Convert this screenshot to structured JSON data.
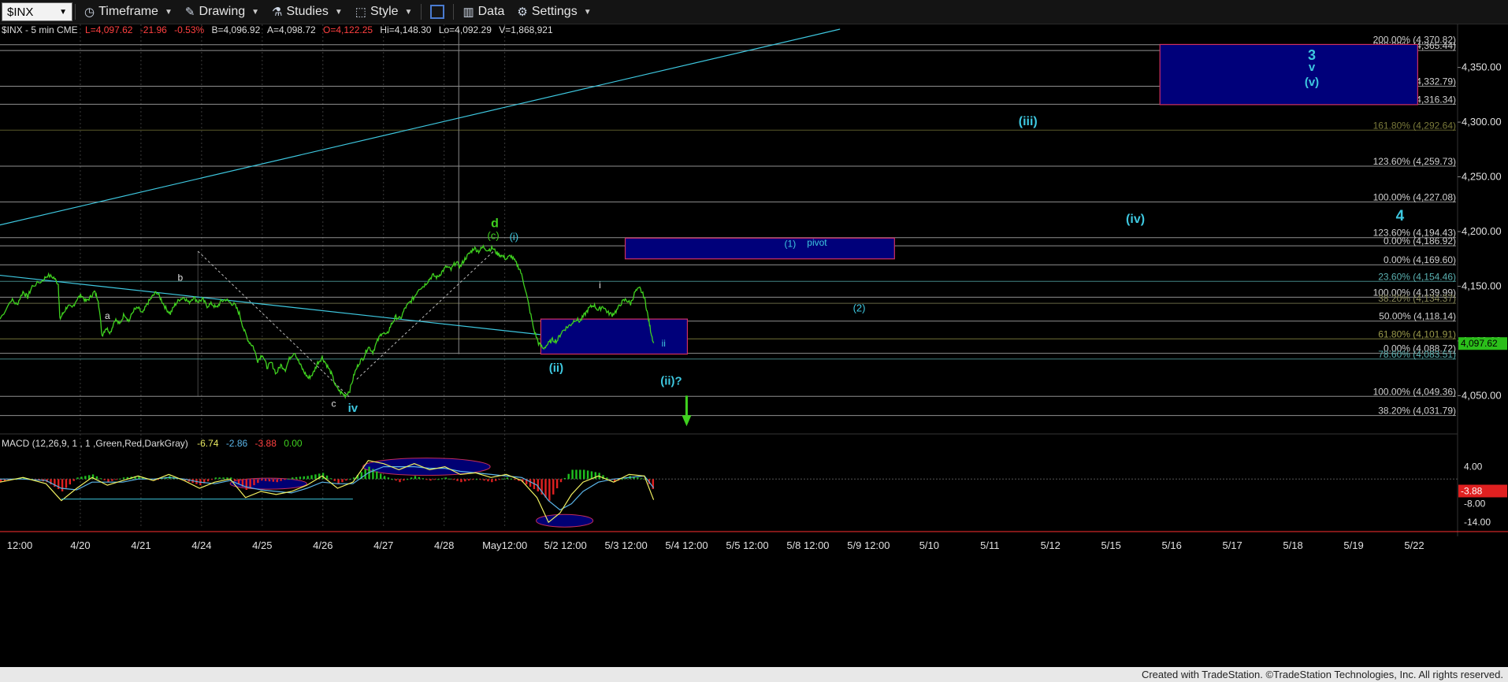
{
  "toolbar": {
    "symbol": "$INX",
    "timeframe": "Timeframe",
    "drawing": "Drawing",
    "studies": "Studies",
    "style": "Style",
    "data": "Data",
    "settings": "Settings"
  },
  "header": {
    "symbol_desc": "$INX - 5 min  CME",
    "last": "L=4,097.62",
    "chg": "-21.96",
    "pct": "-0.53%",
    "bid": "B=4,096.92",
    "ask": "A=4,098.72",
    "open": "O=4,122.25",
    "high": "Hi=4,148.30",
    "low": "Lo=4,092.29",
    "vol": "V=1,868,921"
  },
  "macd_header": {
    "name": "MACD (12,26,9, 1 , 1 ,Green,Red,DarkGray)",
    "v1": "-6.74",
    "v2": "-2.86",
    "v3": "-3.88",
    "v4": "0.00"
  },
  "footer": "Created with TradeStation. ©TradeStation Technologies, Inc. All rights reserved.",
  "colors": {
    "price": "#3fd11f",
    "cyan": "#3ec8e0",
    "box": "#00007a",
    "boxBorder": "#d03060",
    "macd": "#f0f060",
    "signal": "#5ab4e8"
  },
  "chart_data": {
    "type": "line",
    "price_axis": {
      "min": 4015,
      "max": 4385,
      "ticks": [
        {
          "v": 4350,
          "label": "4,350.00"
        },
        {
          "v": 4300,
          "label": "4,300.00"
        },
        {
          "v": 4250,
          "label": "4,250.00"
        },
        {
          "v": 4200,
          "label": "4,200.00"
        },
        {
          "v": 4150,
          "label": "4,150.00"
        },
        {
          "v": 4100,
          "label": "4,100.00"
        },
        {
          "v": 4050,
          "label": "4,050.00"
        }
      ],
      "last_value": 4097.62,
      "last_label": "4,097.62"
    },
    "date_axis": {
      "labels": [
        "12:00",
        "4/20",
        "4/21",
        "4/24",
        "4/25",
        "4/26",
        "4/27",
        "4/28",
        "May12:00",
        "5/2 12:00",
        "5/3 12:00",
        "5/4 12:00",
        "5/5 12:00",
        "5/8 12:00",
        "5/9 12:00",
        "5/10",
        "5/11",
        "5/12",
        "5/15",
        "5/16",
        "5/17",
        "5/18",
        "5/19",
        "5/22"
      ]
    },
    "price_series": [
      {
        "t": 0,
        "v": 4120
      },
      {
        "t": 1.5,
        "v": 4138
      },
      {
        "t": 2.2,
        "v": 4133
      },
      {
        "t": 3,
        "v": 4145
      },
      {
        "t": 3.6,
        "v": 4140
      },
      {
        "t": 4.2,
        "v": 4150
      },
      {
        "t": 5.5,
        "v": 4155
      },
      {
        "t": 6.2,
        "v": 4160
      },
      {
        "t": 7,
        "v": 4158
      },
      {
        "t": 7.6,
        "v": 4152
      },
      {
        "t": 7.8,
        "v": 4120
      },
      {
        "t": 8.2,
        "v": 4125
      },
      {
        "t": 8.8,
        "v": 4132
      },
      {
        "t": 9.4,
        "v": 4130
      },
      {
        "t": 10,
        "v": 4138
      },
      {
        "t": 10.6,
        "v": 4142
      },
      {
        "t": 11.2,
        "v": 4136
      },
      {
        "t": 11.8,
        "v": 4140
      },
      {
        "t": 12.3,
        "v": 4145
      },
      {
        "t": 12.8,
        "v": 4138
      },
      {
        "t": 13.3,
        "v": 4105
      },
      {
        "t": 13.8,
        "v": 4112
      },
      {
        "t": 14.4,
        "v": 4108
      },
      {
        "t": 15.0,
        "v": 4120
      },
      {
        "t": 15.6,
        "v": 4115
      },
      {
        "t": 16.2,
        "v": 4125
      },
      {
        "t": 16.8,
        "v": 4118
      },
      {
        "t": 17.4,
        "v": 4128
      },
      {
        "t": 18.0,
        "v": 4130
      },
      {
        "t": 18.6,
        "v": 4125
      },
      {
        "t": 19.2,
        "v": 4134
      },
      {
        "t": 19.8,
        "v": 4140
      },
      {
        "t": 20.4,
        "v": 4145
      },
      {
        "t": 21.0,
        "v": 4138
      },
      {
        "t": 21.6,
        "v": 4130
      },
      {
        "t": 22.2,
        "v": 4125
      },
      {
        "t": 22.8,
        "v": 4133
      },
      {
        "t": 23.4,
        "v": 4138
      },
      {
        "t": 24.0,
        "v": 4140
      },
      {
        "t": 24.6,
        "v": 4135
      },
      {
        "t": 25.2,
        "v": 4140
      },
      {
        "t": 25.8,
        "v": 4136
      },
      {
        "t": 26.4,
        "v": 4138
      },
      {
        "t": 27.0,
        "v": 4132
      },
      {
        "t": 27.6,
        "v": 4134
      },
      {
        "t": 28.2,
        "v": 4130
      },
      {
        "t": 28.8,
        "v": 4136
      },
      {
        "t": 29.4,
        "v": 4138
      },
      {
        "t": 30.0,
        "v": 4135
      },
      {
        "t": 30.6,
        "v": 4133
      },
      {
        "t": 31.2,
        "v": 4125
      },
      {
        "t": 31.8,
        "v": 4110
      },
      {
        "t": 32.4,
        "v": 4100
      },
      {
        "t": 33.0,
        "v": 4095
      },
      {
        "t": 33.6,
        "v": 4082
      },
      {
        "t": 34.2,
        "v": 4088
      },
      {
        "t": 34.8,
        "v": 4076
      },
      {
        "t": 35.4,
        "v": 4080
      },
      {
        "t": 36.0,
        "v": 4070
      },
      {
        "t": 36.6,
        "v": 4078
      },
      {
        "t": 37.2,
        "v": 4074
      },
      {
        "t": 37.8,
        "v": 4085
      },
      {
        "t": 38.4,
        "v": 4090
      },
      {
        "t": 39.0,
        "v": 4080
      },
      {
        "t": 39.6,
        "v": 4072
      },
      {
        "t": 40.2,
        "v": 4066
      },
      {
        "t": 40.8,
        "v": 4070
      },
      {
        "t": 41.4,
        "v": 4080
      },
      {
        "t": 42.0,
        "v": 4085
      },
      {
        "t": 42.6,
        "v": 4078
      },
      {
        "t": 43.2,
        "v": 4070
      },
      {
        "t": 43.8,
        "v": 4058
      },
      {
        "t": 44.4,
        "v": 4053
      },
      {
        "t": 45.0,
        "v": 4050
      },
      {
        "t": 45.6,
        "v": 4055
      },
      {
        "t": 46.2,
        "v": 4070
      },
      {
        "t": 46.8,
        "v": 4080
      },
      {
        "t": 47.4,
        "v": 4085
      },
      {
        "t": 48.0,
        "v": 4095
      },
      {
        "t": 48.6,
        "v": 4090
      },
      {
        "t": 49.2,
        "v": 4100
      },
      {
        "t": 49.8,
        "v": 4108
      },
      {
        "t": 50.4,
        "v": 4105
      },
      {
        "t": 51.0,
        "v": 4115
      },
      {
        "t": 51.6,
        "v": 4122
      },
      {
        "t": 52.2,
        "v": 4120
      },
      {
        "t": 52.8,
        "v": 4130
      },
      {
        "t": 53.4,
        "v": 4135
      },
      {
        "t": 54.0,
        "v": 4140
      },
      {
        "t": 54.6,
        "v": 4148
      },
      {
        "t": 55.2,
        "v": 4150
      },
      {
        "t": 55.8,
        "v": 4155
      },
      {
        "t": 56.4,
        "v": 4160
      },
      {
        "t": 57.0,
        "v": 4158
      },
      {
        "t": 57.6,
        "v": 4163
      },
      {
        "t": 58.2,
        "v": 4168
      },
      {
        "t": 58.8,
        "v": 4165
      },
      {
        "t": 59.4,
        "v": 4172
      },
      {
        "t": 60.0,
        "v": 4168
      },
      {
        "t": 60.6,
        "v": 4175
      },
      {
        "t": 61.2,
        "v": 4180
      },
      {
        "t": 61.8,
        "v": 4185
      },
      {
        "t": 62.4,
        "v": 4182
      },
      {
        "t": 63.0,
        "v": 4186
      },
      {
        "t": 63.6,
        "v": 4183
      },
      {
        "t": 64.2,
        "v": 4185
      },
      {
        "t": 64.8,
        "v": 4180
      },
      {
        "t": 65.4,
        "v": 4178
      },
      {
        "t": 66.0,
        "v": 4175
      },
      {
        "t": 66.6,
        "v": 4178
      },
      {
        "t": 67.2,
        "v": 4172
      },
      {
        "t": 67.8,
        "v": 4165
      },
      {
        "t": 68.4,
        "v": 4150
      },
      {
        "t": 69.0,
        "v": 4130
      },
      {
        "t": 69.6,
        "v": 4110
      },
      {
        "t": 70.2,
        "v": 4098
      },
      {
        "t": 70.8,
        "v": 4093
      },
      {
        "t": 71.4,
        "v": 4097
      },
      {
        "t": 72.0,
        "v": 4101
      },
      {
        "t": 72.6,
        "v": 4100
      },
      {
        "t": 73.2,
        "v": 4108
      },
      {
        "t": 73.8,
        "v": 4112
      },
      {
        "t": 74.4,
        "v": 4115
      },
      {
        "t": 75.0,
        "v": 4120
      },
      {
        "t": 75.6,
        "v": 4118
      },
      {
        "t": 76.2,
        "v": 4124
      },
      {
        "t": 76.8,
        "v": 4130
      },
      {
        "t": 77.4,
        "v": 4133
      },
      {
        "t": 78.0,
        "v": 4128
      },
      {
        "t": 78.6,
        "v": 4132
      },
      {
        "t": 79.2,
        "v": 4126
      },
      {
        "t": 79.8,
        "v": 4124
      },
      {
        "t": 80.4,
        "v": 4128
      },
      {
        "t": 81.0,
        "v": 4135
      },
      {
        "t": 81.6,
        "v": 4138
      },
      {
        "t": 82.2,
        "v": 4134
      },
      {
        "t": 82.8,
        "v": 4145
      },
      {
        "t": 83.4,
        "v": 4148
      },
      {
        "t": 84.0,
        "v": 4140
      },
      {
        "t": 84.4,
        "v": 4125
      },
      {
        "t": 84.8,
        "v": 4110
      },
      {
        "t": 85.2,
        "v": 4098
      }
    ],
    "fib_lines": [
      {
        "v": 4370.82,
        "label": "200.00% (4,370.82)",
        "color": "#bfbfbf"
      },
      {
        "v": 4365.44,
        "label": "200.00% (4,365.44)",
        "color": "#bfbfbf"
      },
      {
        "v": 4332.79,
        "label": "176.40% (4,332.79)",
        "color": "#bfbfbf"
      },
      {
        "v": 4316.34,
        "label": "176.40% (4,316.34)",
        "color": "#bfbfbf"
      },
      {
        "v": 4292.64,
        "label": "161.80% (4,292.64)",
        "color": "#7a7a3a"
      },
      {
        "v": 4259.73,
        "label": "123.60% (4,259.73)",
        "color": "#bfbfbf"
      },
      {
        "v": 4227.08,
        "label": "100.00% (4,227.08)",
        "color": "#bfbfbf"
      },
      {
        "v": 4194.43,
        "label": "123.60% (4,194.43)",
        "color": "#bfbfbf"
      },
      {
        "v": 4186.92,
        "label": "0.00% (4,186.92)",
        "color": "#bfbfbf"
      },
      {
        "v": 4169.6,
        "label": "0.00% (4,169.60)",
        "color": "#bfbfbf"
      },
      {
        "v": 4154.46,
        "label": "23.60% (4,154.46)",
        "color": "#5ab0b0"
      },
      {
        "v": 4139.99,
        "label": "100.00% (4,139.99)",
        "color": "#bfbfbf"
      },
      {
        "v": 4134.37,
        "label": "38.20% (4,134.37)",
        "color": "#8a8a5a"
      },
      {
        "v": 4118.14,
        "label": "50.00% (4,118.14)",
        "color": "#bfbfbf"
      },
      {
        "v": 4101.91,
        "label": "61.80% (4,101.91)",
        "color": "#9a9a4a"
      },
      {
        "v": 4088.72,
        "label": "0.00% (4,088.72)",
        "color": "#bfbfbf"
      },
      {
        "v": 4083.51,
        "label": "78.60% (4,083.51)",
        "color": "#5ab0b0"
      },
      {
        "v": 4049.36,
        "label": "100.00% (4,049.36)",
        "color": "#bfbfbf"
      },
      {
        "v": 4031.79,
        "label": "38.20% (4,031.79)",
        "color": "#bfbfbf"
      }
    ],
    "wave_labels": [
      {
        "text": "a",
        "t": 14,
        "v": 4120,
        "color": "#e0e0e0",
        "size": 12
      },
      {
        "text": "b",
        "t": 23.5,
        "v": 4155,
        "color": "#e0e0e0",
        "size": 12
      },
      {
        "text": "c",
        "t": 43.5,
        "v": 4040,
        "color": "#e0e0e0",
        "size": 12
      },
      {
        "text": "iv",
        "t": 46,
        "v": 4035,
        "color": "#3ec8e0",
        "size": 15
      },
      {
        "text": "d",
        "t": 64.5,
        "v": 4204,
        "color": "#3fd11f",
        "size": 16
      },
      {
        "text": "(c)",
        "t": 64.3,
        "v": 4193,
        "color": "#3fd11f",
        "size": 13
      },
      {
        "text": "(i)",
        "t": 67,
        "v": 4192,
        "color": "#3ec8e0",
        "size": 13
      },
      {
        "text": "(ii)",
        "t": 72.5,
        "v": 4072,
        "color": "#3ec8e0",
        "size": 15
      },
      {
        "text": "i",
        "t": 78.2,
        "v": 4148,
        "color": "#e0e0e0",
        "size": 12
      },
      {
        "text": "ii",
        "t": 86.5,
        "v": 4095,
        "color": "#3ec8e0",
        "size": 12
      },
      {
        "text": "(ii)?",
        "t": 87.5,
        "v": 4060,
        "color": "#3ec8e0",
        "size": 15
      },
      {
        "text": "(1)",
        "t": 103,
        "v": 4186,
        "color": "#3ec8e0",
        "size": 12
      },
      {
        "text": "pivot",
        "t": 106.5,
        "v": 4187,
        "color": "#3ec8e0",
        "size": 12
      },
      {
        "text": "(2)",
        "t": 112,
        "v": 4127,
        "color": "#3ec8e0",
        "size": 13
      },
      {
        "text": "(iii)",
        "t": 134,
        "v": 4297,
        "color": "#3ec8e0",
        "size": 16
      },
      {
        "text": "(iv)",
        "t": 148,
        "v": 4208,
        "color": "#3ec8e0",
        "size": 16
      },
      {
        "text": "3",
        "t": 171,
        "v": 4357,
        "color": "#3ec8e0",
        "size": 18
      },
      {
        "text": "v",
        "t": 171,
        "v": 4347,
        "color": "#3ec8e0",
        "size": 15
      },
      {
        "text": "(v)",
        "t": 171,
        "v": 4333,
        "color": "#3ec8e0",
        "size": 15
      },
      {
        "text": "4",
        "t": 182.5,
        "v": 4210,
        "color": "#3ec8e0",
        "size": 19
      }
    ],
    "macd_axis": {
      "ticks": [
        {
          "v": 4,
          "label": "4.00"
        },
        {
          "v": -8,
          "label": "-8.00"
        },
        {
          "v": -14,
          "label": "-14.00"
        }
      ],
      "min": -16,
      "max": 9,
      "last_value": -3.88,
      "last_label": "-3.88"
    },
    "macd_series": [
      {
        "t": 0,
        "m": -1,
        "s": 0
      },
      {
        "t": 3,
        "m": 0.5,
        "s": 0
      },
      {
        "t": 6,
        "m": -1.5,
        "s": -0.5
      },
      {
        "t": 8,
        "m": -7,
        "s": -3
      },
      {
        "t": 10,
        "m": -3,
        "s": -3.5
      },
      {
        "t": 12,
        "m": 0.5,
        "s": -1
      },
      {
        "t": 14,
        "m": -2,
        "s": -1
      },
      {
        "t": 16,
        "m": -0.5,
        "s": -1
      },
      {
        "t": 18,
        "m": 1,
        "s": 0
      },
      {
        "t": 20,
        "m": -0.5,
        "s": 0
      },
      {
        "t": 22,
        "m": 1.5,
        "s": 0.5
      },
      {
        "t": 24,
        "m": -0.5,
        "s": 0
      },
      {
        "t": 26,
        "m": -3,
        "s": -1
      },
      {
        "t": 28,
        "m": -1,
        "s": -1.5
      },
      {
        "t": 30,
        "m": 0,
        "s": -0.5
      },
      {
        "t": 32,
        "m": -6,
        "s": -2.5
      },
      {
        "t": 34,
        "m": -4,
        "s": -3.5
      },
      {
        "t": 36,
        "m": -5,
        "s": -4
      },
      {
        "t": 38,
        "m": -4,
        "s": -4.5
      },
      {
        "t": 40,
        "m": -2,
        "s": -3
      },
      {
        "t": 42,
        "m": 1,
        "s": -1
      },
      {
        "t": 44,
        "m": -3,
        "s": -1.5
      },
      {
        "t": 46,
        "m": -1,
        "s": -1.5
      },
      {
        "t": 48,
        "m": 6,
        "s": 2
      },
      {
        "t": 50,
        "m": 5,
        "s": 4
      },
      {
        "t": 52,
        "m": 3,
        "s": 4
      },
      {
        "t": 54,
        "m": 5,
        "s": 4
      },
      {
        "t": 56,
        "m": 3,
        "s": 3.5
      },
      {
        "t": 58,
        "m": 4,
        "s": 3.5
      },
      {
        "t": 60,
        "m": 1.5,
        "s": 2.5
      },
      {
        "t": 62,
        "m": 2,
        "s": 2
      },
      {
        "t": 64,
        "m": 0.5,
        "s": 1.5
      },
      {
        "t": 66,
        "m": 1.5,
        "s": 1
      },
      {
        "t": 68,
        "m": -0.5,
        "s": 0.5
      },
      {
        "t": 70,
        "m": -6,
        "s": -2
      },
      {
        "t": 71.5,
        "m": -14,
        "s": -7
      },
      {
        "t": 73,
        "m": -11,
        "s": -10
      },
      {
        "t": 74.5,
        "m": -5,
        "s": -8
      },
      {
        "t": 76,
        "m": -1,
        "s": -4
      },
      {
        "t": 78,
        "m": 1,
        "s": -1
      },
      {
        "t": 80,
        "m": -1,
        "s": 0
      },
      {
        "t": 82,
        "m": 1.5,
        "s": 0.5
      },
      {
        "t": 84,
        "m": 1,
        "s": 1
      },
      {
        "t": 85.2,
        "m": -6.74,
        "s": -2.86
      }
    ]
  }
}
